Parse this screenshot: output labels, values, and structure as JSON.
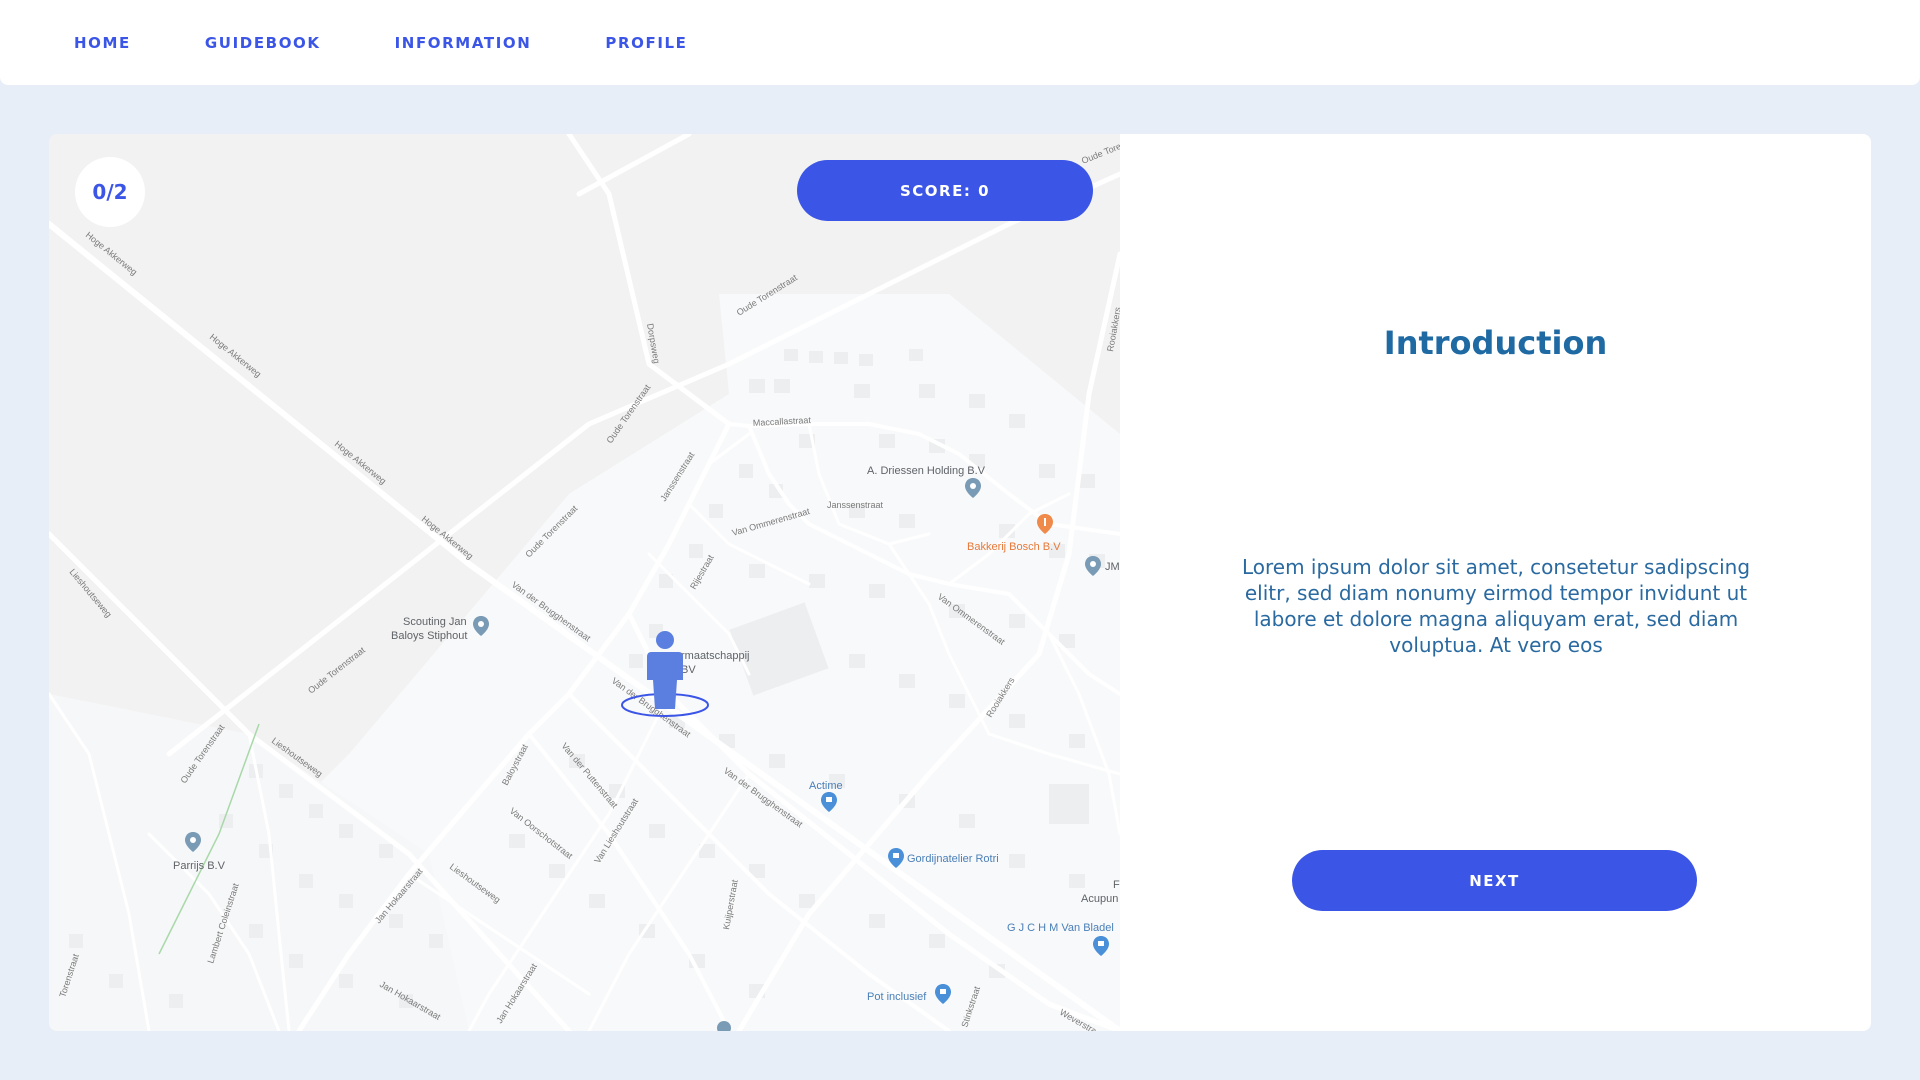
{
  "nav": {
    "items": [
      {
        "label": "HOME"
      },
      {
        "label": "GUIDEBOOK"
      },
      {
        "label": "INFORMATION"
      },
      {
        "label": "PROFILE"
      }
    ]
  },
  "game": {
    "progress": "0/2",
    "score": "SCORE: 0"
  },
  "map": {
    "places": [
      {
        "name": "A. Driessen Holding B.V"
      },
      {
        "name": "Bakkerij Bosch B.V"
      },
      {
        "name": "JM"
      },
      {
        "name": "Scouting Jan"
      },
      {
        "name": "Baloys Stiphout"
      },
      {
        "name": "rmaatschappij"
      },
      {
        "name": "BV"
      },
      {
        "name": "Actime"
      },
      {
        "name": "Gordijnatelier Rotri"
      },
      {
        "name": "Parrijs B.V"
      },
      {
        "name": "Acupun"
      },
      {
        "name": "G J C H M Van Bladel"
      },
      {
        "name": "Pot inclusief"
      },
      {
        "name": "F"
      }
    ],
    "streets": [
      {
        "name": "Hoge Akkerweg"
      },
      {
        "name": "Hoge Akkerweg"
      },
      {
        "name": "Hoge Akkerweg"
      },
      {
        "name": "Hoge Akkerweg"
      },
      {
        "name": "Oude Torenstraat"
      },
      {
        "name": "Oude Torenstraat"
      },
      {
        "name": "Oude Torenstraat"
      },
      {
        "name": "Oude Torenstraat"
      },
      {
        "name": "Oude Torenstraat"
      },
      {
        "name": "Dorpsweg"
      },
      {
        "name": "Maccallastraat"
      },
      {
        "name": "Janssenstraat"
      },
      {
        "name": "Janssenstraat"
      },
      {
        "name": "Van Ommerenstraat"
      },
      {
        "name": "Van Ommerenstraat"
      },
      {
        "name": "Rijestraat"
      },
      {
        "name": "Van der Brugghenstraat"
      },
      {
        "name": "Van der Brugghenstraat"
      },
      {
        "name": "Van der Brugghenstraat"
      },
      {
        "name": "Rooiakkers"
      },
      {
        "name": "Rooiakkers"
      },
      {
        "name": "Lieshoutseweg"
      },
      {
        "name": "Lieshoutseweg"
      },
      {
        "name": "Lieshoutseweg"
      },
      {
        "name": "Baloystraat"
      },
      {
        "name": "Van der Puttenstraat"
      },
      {
        "name": "Van Oorschotstraat"
      },
      {
        "name": "Van Lieshoutstraat"
      },
      {
        "name": "Jan Hokaarstraat"
      },
      {
        "name": "Jan Hokaarstraat"
      },
      {
        "name": "Jan Hokaarstraat"
      },
      {
        "name": "Lambert Coleinstraat"
      },
      {
        "name": "Kuijperstraat"
      },
      {
        "name": "Torenstraat"
      },
      {
        "name": "Stinkstraat"
      },
      {
        "name": "Weverstraat"
      },
      {
        "name": "Oude Tore"
      }
    ]
  },
  "intro": {
    "title": "Introduction",
    "body": "Lorem ipsum dolor sit amet, consetetur sadipscing elitr, sed diam nonumy eirmod tempor invidunt ut labore et dolore magna aliquyam erat, sed diam voluptua. At vero eos",
    "next_label": "NEXT"
  },
  "colors": {
    "accent": "#3b55e6",
    "title": "#1f6aa3",
    "background": "#e7eef7",
    "map_pin": "#7a9bb5",
    "food_pin": "#f08a4b",
    "shop_pin": "#4a90d9"
  }
}
